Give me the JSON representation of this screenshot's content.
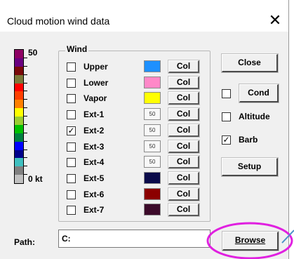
{
  "window": {
    "title": "Cloud motion wind data",
    "close_glyph": "✕"
  },
  "scale": {
    "top_label": "50",
    "bottom_label": "0 kt",
    "colors": [
      "#8e0064",
      "#6a0080",
      "#7a0a0a",
      "#7a7a3a",
      "#ff0000",
      "#ff4000",
      "#ff8000",
      "#ffff00",
      "#9acd32",
      "#00c000",
      "#008040",
      "#0000ff",
      "#00008b",
      "#40c0c0",
      "#808080",
      "#c0c0c0"
    ]
  },
  "wind": {
    "group_title": "Wind",
    "col_label": "Col",
    "rows": [
      {
        "label": "Upper",
        "checked": false,
        "swatch_color": "#1e90ff",
        "swatch_text": ""
      },
      {
        "label": "Lower",
        "checked": false,
        "swatch_color": "#ff88c8",
        "swatch_text": ""
      },
      {
        "label": "Vapor",
        "checked": false,
        "swatch_color": "#ffff00",
        "swatch_text": ""
      },
      {
        "label": "Ext-1",
        "checked": false,
        "swatch_color": "#f8f8f8",
        "swatch_text": "50"
      },
      {
        "label": "Ext-2",
        "checked": true,
        "swatch_color": "#f8f8f8",
        "swatch_text": "50"
      },
      {
        "label": "Ext-3",
        "checked": false,
        "swatch_color": "#f8f8f8",
        "swatch_text": "50"
      },
      {
        "label": "Ext-4",
        "checked": false,
        "swatch_color": "#f8f8f8",
        "swatch_text": "50"
      },
      {
        "label": "Ext-5",
        "checked": false,
        "swatch_color": "#0a0a4a",
        "swatch_text": ""
      },
      {
        "label": "Ext-6",
        "checked": false,
        "swatch_color": "#8b0000",
        "swatch_text": ""
      },
      {
        "label": "Ext-7",
        "checked": false,
        "swatch_color": "#3c0a2a",
        "swatch_text": ""
      }
    ]
  },
  "side": {
    "close_button": "Close",
    "cond_label": "Cond",
    "cond_checked": false,
    "altitude_label": "Altitude",
    "altitude_checked": false,
    "barb_label": "Barb",
    "barb_checked": true,
    "setup_button": "Setup"
  },
  "path": {
    "label": "Path:",
    "value": "C:",
    "browse_button": "Browse"
  },
  "colors": {
    "annotation_ellipse": "#e020e0",
    "annotation_arrow": "#4a90c8"
  },
  "check_glyph": "✓"
}
